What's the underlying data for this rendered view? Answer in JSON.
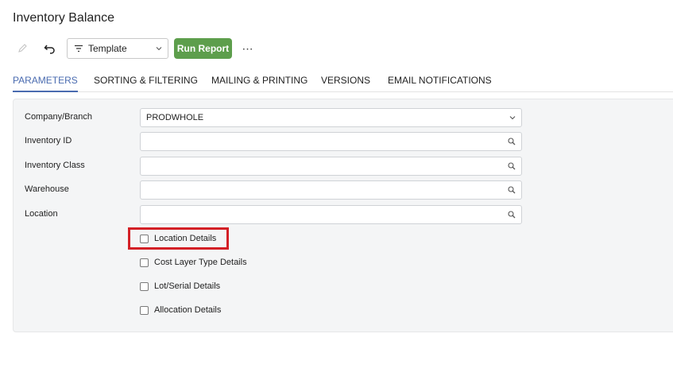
{
  "page": {
    "title": "Inventory Balance"
  },
  "toolbar": {
    "edit_icon": "pencil-icon",
    "undo_icon": "undo-icon",
    "template_label": "Template",
    "run_label": "Run Report",
    "more_label": "⋯"
  },
  "tabs": [
    {
      "label": "PARAMETERS",
      "active": true
    },
    {
      "label": "SORTING & FILTERING",
      "active": false
    },
    {
      "label": "MAILING & PRINTING",
      "active": false
    },
    {
      "label": "VERSIONS",
      "active": false
    },
    {
      "label": "EMAIL NOTIFICATIONS",
      "active": false
    }
  ],
  "params": {
    "fields": [
      {
        "label": "Company/Branch",
        "value": "PRODWHOLE",
        "control": "dropdown"
      },
      {
        "label": "Inventory ID",
        "value": "",
        "control": "lookup"
      },
      {
        "label": "Inventory Class",
        "value": "",
        "control": "lookup"
      },
      {
        "label": "Warehouse",
        "value": "",
        "control": "lookup"
      },
      {
        "label": "Location",
        "value": "",
        "control": "lookup"
      }
    ],
    "checkboxes": [
      {
        "label": "Location Details",
        "checked": false
      },
      {
        "label": "Cost Layer Type Details",
        "checked": false
      },
      {
        "label": "Lot/Serial Details",
        "checked": false
      },
      {
        "label": "Allocation Details",
        "checked": false
      }
    ]
  },
  "colors": {
    "accent": "#4a6bb0",
    "run_button": "#5d9e4c",
    "highlight": "#d32026"
  }
}
